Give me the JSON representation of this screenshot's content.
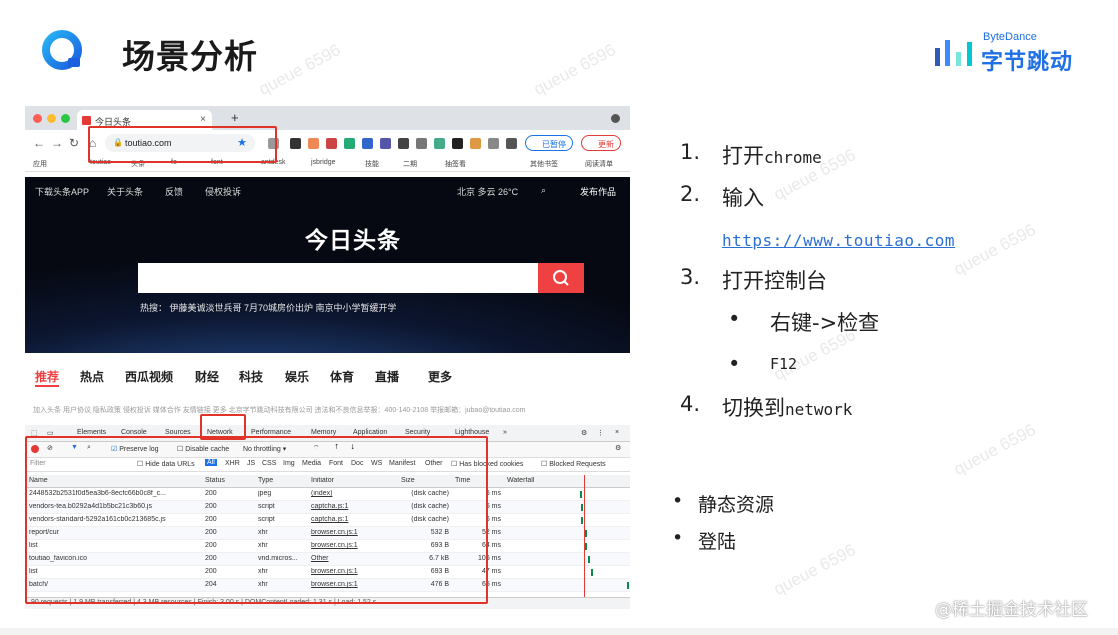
{
  "slide": {
    "title": "场景分析",
    "brand_small": "ByteDance",
    "brand_big": "字节跳动",
    "watermark": "queue 6596",
    "credit": "@稀土掘金技术社区"
  },
  "browser": {
    "tab_title": "今日头条",
    "url": "toutiao.com",
    "profile_label": "已暂停",
    "update_label": "更新",
    "bookmarks": [
      "应用",
      "toutiao",
      "头条",
      "fe",
      "font",
      "antdesk",
      "jsbridge",
      "技能",
      "二期",
      "抽签看",
      "其他书签",
      "阅读清单"
    ]
  },
  "page": {
    "nav_left": [
      "下载头条APP",
      "关于头条",
      "反馈",
      "侵权投诉"
    ],
    "weather": "北京  多云  26°C",
    "publish": "发布作品",
    "hero_title": "今日头条",
    "hot_text": "热搜：  伊藤美诚淡世兵哥    7月70城房价出炉    南京中小学暂缓开学",
    "categories": [
      "推荐",
      "热点",
      "西瓜视频",
      "财经",
      "科技",
      "娱乐",
      "体育",
      "直播",
      "更多"
    ],
    "subnav": "加入头条   用户协议   隐私政策   侵权投诉   媒体合作   友情链接   更多      北京字节跳动科技有限公司   违法和不良信息举报：400-140-2108   举报邮箱：jubao@toutiao.com"
  },
  "devtools": {
    "tabs": [
      "Elements",
      "Console",
      "Sources",
      "Network",
      "Performance",
      "Memory",
      "Application",
      "Security",
      "Lighthouse"
    ],
    "preserve_log": "Preserve log",
    "disable_cache": "Disable cache",
    "throttling": "No throttling",
    "filter_placeholder": "Filter",
    "hide_data_urls": "Hide data URLs",
    "type_filters": [
      "All",
      "XHR",
      "JS",
      "CSS",
      "Img",
      "Media",
      "Font",
      "Doc",
      "WS",
      "Manifest",
      "Other"
    ],
    "has_blocked_cookies": "Has blocked cookies",
    "blocked_requests": "Blocked Requests",
    "columns": {
      "name": "Name",
      "status": "Status",
      "type": "Type",
      "initiator": "Initiator",
      "size": "Size",
      "time": "Time",
      "waterfall": "Waterfall"
    },
    "rows": [
      {
        "name": "2448532b2531f0d5ea3b6-8ecfc66b0c8f_c...",
        "status": "200",
        "type": "jpeg",
        "initiator": "(index)",
        "size": "(disk cache)",
        "time": "5 ms"
      },
      {
        "name": "vendors-tea.b0292a4d1b5bc21c3b60.js",
        "status": "200",
        "type": "script",
        "initiator": "captcha.js:1",
        "size": "(disk cache)",
        "time": "6 ms"
      },
      {
        "name": "vendors-standard-5292a161cb0c213685c.js",
        "status": "200",
        "type": "script",
        "initiator": "captcha.js:1",
        "size": "(disk cache)",
        "time": "6 ms"
      },
      {
        "name": "report/cur",
        "status": "200",
        "type": "xhr",
        "initiator": "browser.cn.js:1",
        "size": "532 B",
        "time": "52 ms"
      },
      {
        "name": "list",
        "status": "200",
        "type": "xhr",
        "initiator": "browser.cn.js:1",
        "size": "693 B",
        "time": "64 ms"
      },
      {
        "name": "toutiao_favicon.ico",
        "status": "200",
        "type": "vnd.micros...",
        "initiator": "Other",
        "size": "6.7 kB",
        "time": "106 ms"
      },
      {
        "name": "list",
        "status": "200",
        "type": "xhr",
        "initiator": "browser.cn.js:1",
        "size": "693 B",
        "time": "47 ms"
      },
      {
        "name": "batch/",
        "status": "204",
        "type": "xhr",
        "initiator": "browser.cn.js:1",
        "size": "476 B",
        "time": "65 ms"
      }
    ],
    "status_bar": "90 requests  |  1.9 MB transferred  |  4.3 MB resources  |  Finish: 3.00 s  |  DOMContentLoaded: 1.31 s  |  Load: 1.52 s"
  },
  "steps": [
    {
      "num": "1.",
      "text": "打开",
      "mono": "chrome"
    },
    {
      "num": "2.",
      "text": "输入",
      "mono": ""
    },
    {
      "num": "3.",
      "text": "打开控制台",
      "mono": ""
    },
    {
      "num": "4.",
      "text": "切换到",
      "mono": "network"
    }
  ],
  "link": "https://www.toutiao.com",
  "sub_bullets": [
    {
      "text": "右键->检查"
    },
    {
      "text": "F12"
    }
  ],
  "scenarios": [
    "静态资源",
    "登陆"
  ]
}
